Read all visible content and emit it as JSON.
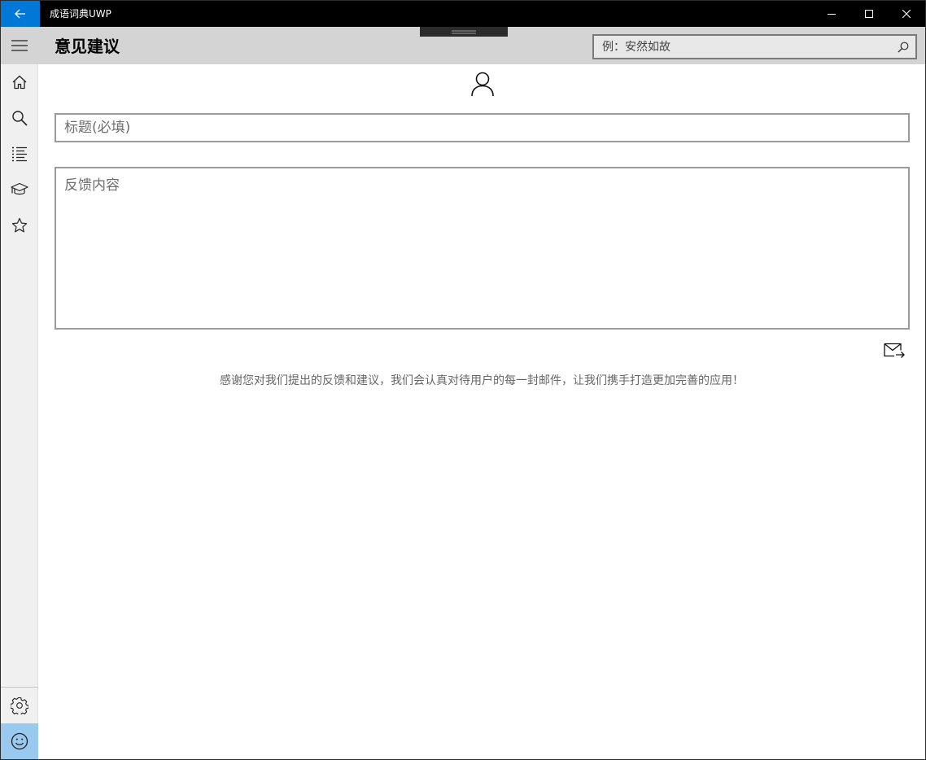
{
  "window": {
    "app_title": "成语词典UWP",
    "accent_color": "#0078d7"
  },
  "titlebar": {
    "back_icon": "arrow-left-icon",
    "minimize_icon": "minimize-icon",
    "maximize_icon": "maximize-icon",
    "close_icon": "close-icon"
  },
  "header": {
    "page_title": "意见建议",
    "search": {
      "placeholder": "例：安然如故",
      "value": "",
      "icon": "search-icon"
    }
  },
  "sidebar": {
    "items": [
      {
        "name": "home",
        "icon": "home-icon"
      },
      {
        "name": "search",
        "icon": "search-icon"
      },
      {
        "name": "list",
        "icon": "list-icon"
      },
      {
        "name": "learn",
        "icon": "graduation-cap-icon"
      },
      {
        "name": "favorites",
        "icon": "star-icon"
      }
    ],
    "bottom_items": [
      {
        "name": "settings",
        "icon": "gear-icon"
      },
      {
        "name": "feedback",
        "icon": "smiley-icon",
        "active": true
      }
    ],
    "active_color": "#99c9ef"
  },
  "feedback": {
    "avatar_icon": "person-icon",
    "title_placeholder": "标题(必填)",
    "title_value": "",
    "content_placeholder": "反馈内容",
    "content_value": "",
    "send_icon": "mail-send-icon",
    "thanks_text": "感谢您对我们提出的反馈和建议，我们会认真对待用户的每一封邮件，让我们携手打造更加完善的应用！"
  }
}
